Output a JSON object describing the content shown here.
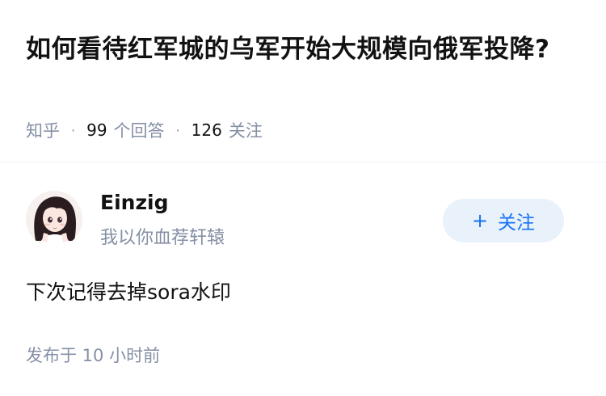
{
  "question": {
    "title": "如何看待红军城的乌军开始大规模向俄军投降?",
    "source": "知乎",
    "answer_count": "99",
    "answer_label": "个回答",
    "follower_count": "126",
    "follower_label": "关注"
  },
  "author": {
    "name": "Einzig",
    "bio": "我以你血荐轩辕",
    "follow_label": "关注",
    "follow_icon": "plus-icon"
  },
  "answer": {
    "content": "下次记得去掉sora水印",
    "published": "发布于  10 小时前"
  },
  "colors": {
    "accent": "#1772f6",
    "follow_bg": "#e9f1fb",
    "muted": "#8590a6",
    "text": "#121212"
  }
}
